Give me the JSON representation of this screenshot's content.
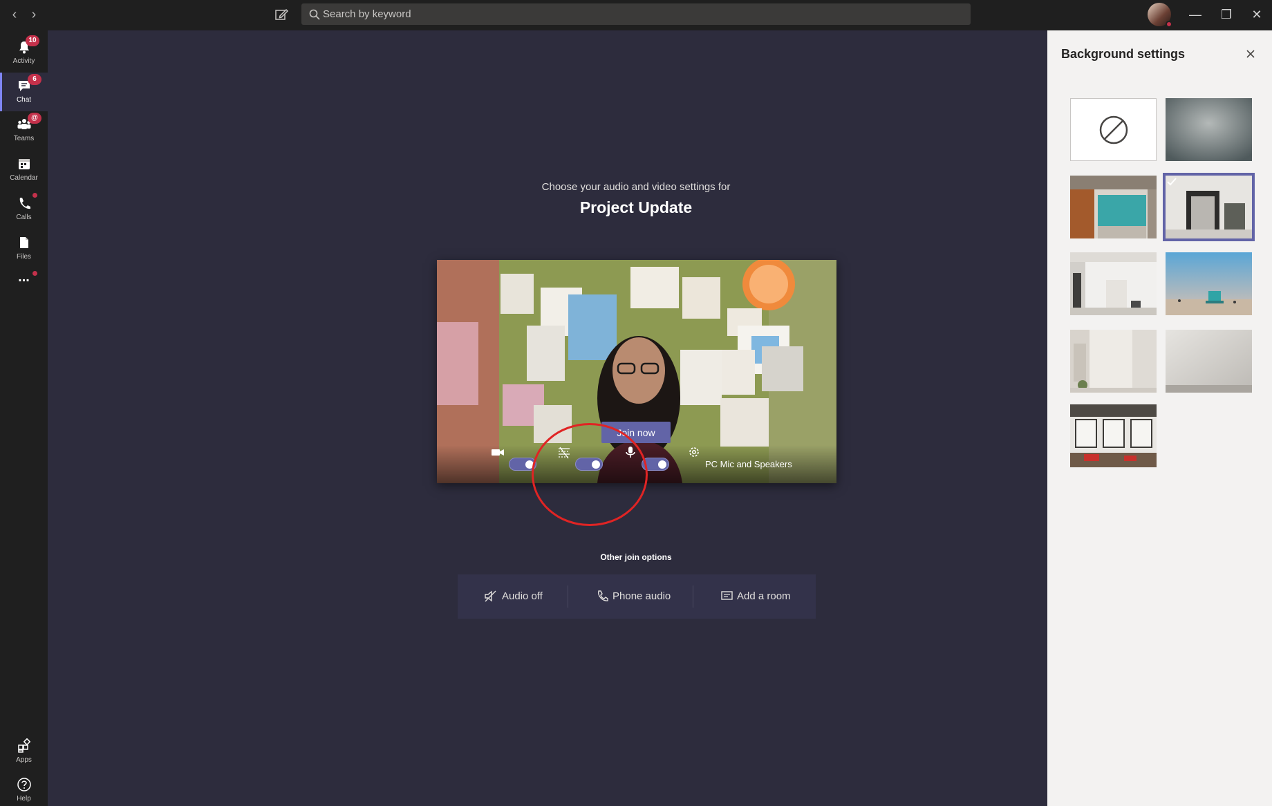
{
  "topbar": {
    "back_icon": "chevron-left-icon",
    "forward_icon": "chevron-right-icon",
    "compose_icon": "compose-icon",
    "search_placeholder": "Search by keyword"
  },
  "rail": {
    "items": [
      {
        "label": "Activity",
        "icon": "bell-icon",
        "badge": "10"
      },
      {
        "label": "Chat",
        "icon": "chat-icon",
        "badge": "6"
      },
      {
        "label": "Teams",
        "icon": "teams-icon",
        "badge": "@"
      },
      {
        "label": "Calendar",
        "icon": "calendar-icon"
      },
      {
        "label": "Calls",
        "icon": "phone-icon"
      },
      {
        "label": "Files",
        "icon": "file-icon"
      },
      {
        "label": "Apps",
        "icon": "apps-icon"
      },
      {
        "label": "Help",
        "icon": "help-icon"
      }
    ],
    "more_label": "..."
  },
  "prejoin": {
    "prompt": "Choose your audio and video settings for",
    "meeting_title": "Project Update",
    "join_label": "Join now",
    "device_label": "PC Mic and Speakers",
    "camera_on": true,
    "blur_on": true,
    "mic_on": true
  },
  "other_options": {
    "title": "Other join options",
    "audio_off": "Audio off",
    "phone_audio": "Phone audio",
    "add_room": "Add a room"
  },
  "background_panel": {
    "title": "Background settings",
    "tiles": [
      "none",
      "blur",
      "office-teal-lockers",
      "doorway-room",
      "white-interior",
      "beach-lifeguard-tower",
      "white-room-plant",
      "plain-wall",
      "loft-office"
    ],
    "selected_tile": "doorway-room"
  },
  "colors": {
    "accent": "#6264a7",
    "rail_bg": "#1f1f1f",
    "stage_bg": "#2d2c3d",
    "badge": "#c4314b",
    "annotation": "#e02424"
  }
}
